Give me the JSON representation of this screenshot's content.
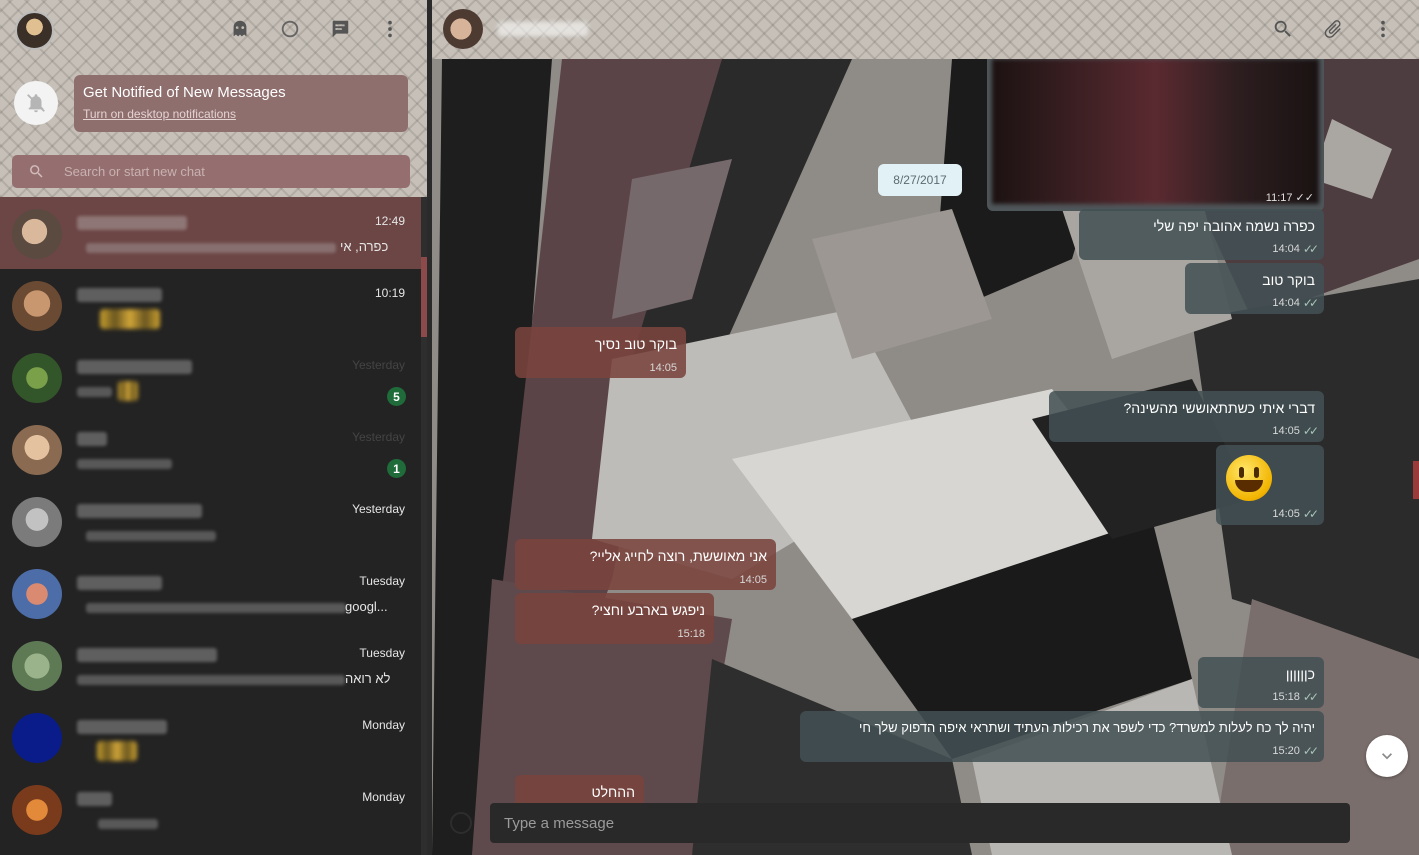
{
  "colors": {
    "accent": "#6c4545",
    "unread_badge": "#1f6b3a",
    "incoming_bubble": "#7a433c",
    "outgoing_bubble": "#425054"
  },
  "sidebar_header": {
    "icons": [
      "ghost-icon",
      "status-icon",
      "new-chat-icon",
      "menu-icon"
    ]
  },
  "notification": {
    "title": "Get Notified of New Messages",
    "link": "Turn on desktop notifications"
  },
  "search": {
    "placeholder": "Search or start new chat"
  },
  "chats": [
    {
      "time": "12:49",
      "preview": "כפרה, אי",
      "unread": "",
      "active": true
    },
    {
      "time": "10:19",
      "preview": "",
      "unread": ""
    },
    {
      "time": "Yesterday",
      "preview": "",
      "unread": "5",
      "muted_time": true
    },
    {
      "time": "Yesterday",
      "preview": "",
      "unread": "1",
      "muted_time": true
    },
    {
      "time": "Yesterday",
      "preview": "",
      "unread": ""
    },
    {
      "time": "Tuesday",
      "preview": "googl...",
      "unread": ""
    },
    {
      "time": "Tuesday",
      "preview": "לא רואה",
      "unread": ""
    },
    {
      "time": "Monday",
      "preview": "",
      "unread": ""
    },
    {
      "time": "Monday",
      "preview": "",
      "unread": ""
    }
  ],
  "conversation": {
    "header_icons": [
      "search-icon",
      "attach-icon",
      "menu-icon"
    ],
    "image_message_time": "11:17",
    "date_chip": "8/27/2017",
    "messages": [
      {
        "dir": "out",
        "text": "כפרה נשמה אהובה יפה שלי",
        "time": "14:04"
      },
      {
        "dir": "out",
        "text": "בוקר טוב",
        "time": "14:04"
      },
      {
        "dir": "in",
        "text": "בוקר טוב נסיך",
        "time": "14:05"
      },
      {
        "dir": "out",
        "text": "דברי איתי כשתתאוששי מהשינה?",
        "time": "14:05"
      },
      {
        "dir": "out",
        "text": "",
        "time": "14:05"
      },
      {
        "dir": "in",
        "text": "אני מאוששת, רוצה לחייג אליי?",
        "time": "14:05"
      },
      {
        "dir": "in",
        "text": "ניפגש בארבע וחצי?",
        "time": "15:18"
      },
      {
        "dir": "out",
        "text": "כןןןןןן",
        "time": "15:18"
      },
      {
        "dir": "out",
        "text": "יהיה לך כח לעלות למשרד? כדי לשפר את רכילות העתיד ושתראי איפה הדפוק שלך חי",
        "time": "15:20"
      },
      {
        "dir": "in",
        "text": "ההחלט",
        "time": ""
      }
    ],
    "composer_placeholder": "Type a message"
  }
}
